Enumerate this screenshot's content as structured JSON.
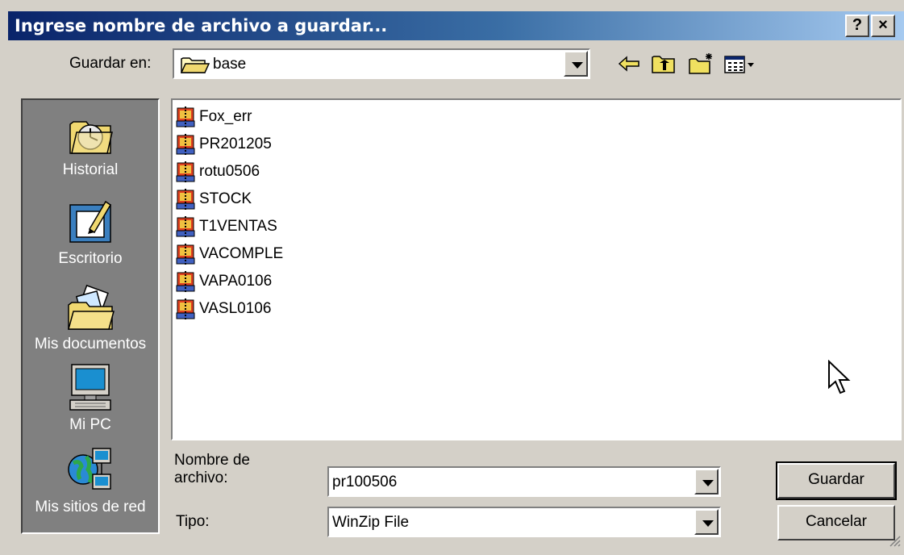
{
  "window": {
    "title": "Ingrese nombre de archivo a guardar...",
    "help_button": "?",
    "close_button": "×"
  },
  "toolbar": {
    "save_in_label": "Guardar en:",
    "save_in_value": "base",
    "back_icon": "back-arrow-icon",
    "up_icon": "up-folder-icon",
    "new_folder_icon": "new-folder-icon",
    "view_menu_icon": "view-menu-icon"
  },
  "places": [
    {
      "label": "Historial",
      "icon": "history-icon"
    },
    {
      "label": "Escritorio",
      "icon": "desktop-icon"
    },
    {
      "label": "Mis documentos",
      "icon": "my-documents-icon"
    },
    {
      "label": "Mi PC",
      "icon": "my-computer-icon"
    },
    {
      "label": "Mis sitios de red",
      "icon": "network-places-icon"
    }
  ],
  "files": [
    "Fox_err",
    "PR201205",
    "rotu0506",
    "STOCK",
    "T1VENTAS",
    "VACOMPLE",
    "VAPA0106",
    "VASL0106"
  ],
  "form": {
    "filename_label_line1": "Nombre de",
    "filename_label_line2": "archivo:",
    "filename_value": "pr100506",
    "type_label": "Tipo:",
    "type_value": "WinZip File"
  },
  "buttons": {
    "save": "Guardar",
    "cancel": "Cancelar"
  },
  "colors": {
    "title_start": "#0a246a",
    "title_end": "#a6caf0",
    "face": "#d4d0c8",
    "places_bg": "#808080"
  }
}
